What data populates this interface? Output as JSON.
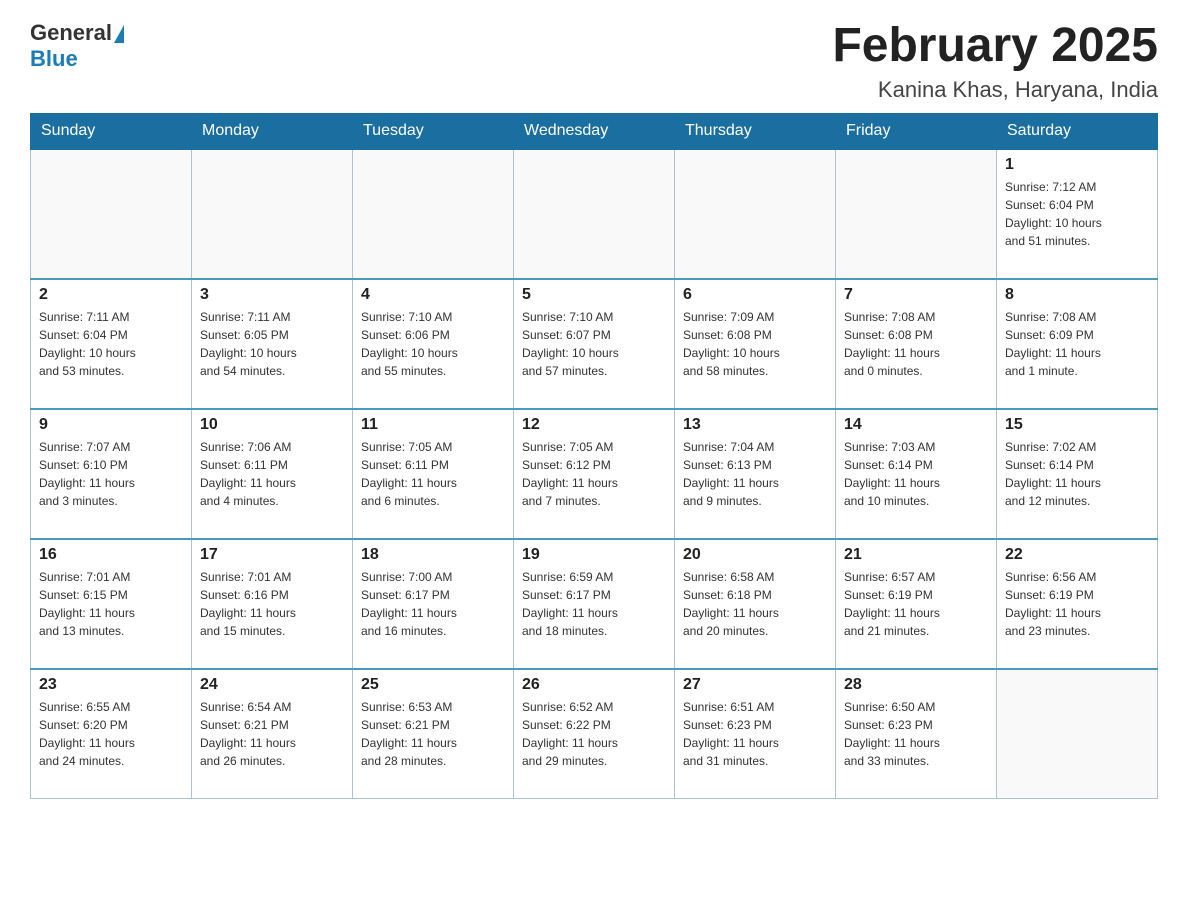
{
  "header": {
    "logo": {
      "general": "General",
      "blue": "Blue"
    },
    "title": "February 2025",
    "subtitle": "Kanina Khas, Haryana, India"
  },
  "weekdays": [
    "Sunday",
    "Monday",
    "Tuesday",
    "Wednesday",
    "Thursday",
    "Friday",
    "Saturday"
  ],
  "weeks": [
    [
      {
        "day": "",
        "info": ""
      },
      {
        "day": "",
        "info": ""
      },
      {
        "day": "",
        "info": ""
      },
      {
        "day": "",
        "info": ""
      },
      {
        "day": "",
        "info": ""
      },
      {
        "day": "",
        "info": ""
      },
      {
        "day": "1",
        "info": "Sunrise: 7:12 AM\nSunset: 6:04 PM\nDaylight: 10 hours\nand 51 minutes."
      }
    ],
    [
      {
        "day": "2",
        "info": "Sunrise: 7:11 AM\nSunset: 6:04 PM\nDaylight: 10 hours\nand 53 minutes."
      },
      {
        "day": "3",
        "info": "Sunrise: 7:11 AM\nSunset: 6:05 PM\nDaylight: 10 hours\nand 54 minutes."
      },
      {
        "day": "4",
        "info": "Sunrise: 7:10 AM\nSunset: 6:06 PM\nDaylight: 10 hours\nand 55 minutes."
      },
      {
        "day": "5",
        "info": "Sunrise: 7:10 AM\nSunset: 6:07 PM\nDaylight: 10 hours\nand 57 minutes."
      },
      {
        "day": "6",
        "info": "Sunrise: 7:09 AM\nSunset: 6:08 PM\nDaylight: 10 hours\nand 58 minutes."
      },
      {
        "day": "7",
        "info": "Sunrise: 7:08 AM\nSunset: 6:08 PM\nDaylight: 11 hours\nand 0 minutes."
      },
      {
        "day": "8",
        "info": "Sunrise: 7:08 AM\nSunset: 6:09 PM\nDaylight: 11 hours\nand 1 minute."
      }
    ],
    [
      {
        "day": "9",
        "info": "Sunrise: 7:07 AM\nSunset: 6:10 PM\nDaylight: 11 hours\nand 3 minutes."
      },
      {
        "day": "10",
        "info": "Sunrise: 7:06 AM\nSunset: 6:11 PM\nDaylight: 11 hours\nand 4 minutes."
      },
      {
        "day": "11",
        "info": "Sunrise: 7:05 AM\nSunset: 6:11 PM\nDaylight: 11 hours\nand 6 minutes."
      },
      {
        "day": "12",
        "info": "Sunrise: 7:05 AM\nSunset: 6:12 PM\nDaylight: 11 hours\nand 7 minutes."
      },
      {
        "day": "13",
        "info": "Sunrise: 7:04 AM\nSunset: 6:13 PM\nDaylight: 11 hours\nand 9 minutes."
      },
      {
        "day": "14",
        "info": "Sunrise: 7:03 AM\nSunset: 6:14 PM\nDaylight: 11 hours\nand 10 minutes."
      },
      {
        "day": "15",
        "info": "Sunrise: 7:02 AM\nSunset: 6:14 PM\nDaylight: 11 hours\nand 12 minutes."
      }
    ],
    [
      {
        "day": "16",
        "info": "Sunrise: 7:01 AM\nSunset: 6:15 PM\nDaylight: 11 hours\nand 13 minutes."
      },
      {
        "day": "17",
        "info": "Sunrise: 7:01 AM\nSunset: 6:16 PM\nDaylight: 11 hours\nand 15 minutes."
      },
      {
        "day": "18",
        "info": "Sunrise: 7:00 AM\nSunset: 6:17 PM\nDaylight: 11 hours\nand 16 minutes."
      },
      {
        "day": "19",
        "info": "Sunrise: 6:59 AM\nSunset: 6:17 PM\nDaylight: 11 hours\nand 18 minutes."
      },
      {
        "day": "20",
        "info": "Sunrise: 6:58 AM\nSunset: 6:18 PM\nDaylight: 11 hours\nand 20 minutes."
      },
      {
        "day": "21",
        "info": "Sunrise: 6:57 AM\nSunset: 6:19 PM\nDaylight: 11 hours\nand 21 minutes."
      },
      {
        "day": "22",
        "info": "Sunrise: 6:56 AM\nSunset: 6:19 PM\nDaylight: 11 hours\nand 23 minutes."
      }
    ],
    [
      {
        "day": "23",
        "info": "Sunrise: 6:55 AM\nSunset: 6:20 PM\nDaylight: 11 hours\nand 24 minutes."
      },
      {
        "day": "24",
        "info": "Sunrise: 6:54 AM\nSunset: 6:21 PM\nDaylight: 11 hours\nand 26 minutes."
      },
      {
        "day": "25",
        "info": "Sunrise: 6:53 AM\nSunset: 6:21 PM\nDaylight: 11 hours\nand 28 minutes."
      },
      {
        "day": "26",
        "info": "Sunrise: 6:52 AM\nSunset: 6:22 PM\nDaylight: 11 hours\nand 29 minutes."
      },
      {
        "day": "27",
        "info": "Sunrise: 6:51 AM\nSunset: 6:23 PM\nDaylight: 11 hours\nand 31 minutes."
      },
      {
        "day": "28",
        "info": "Sunrise: 6:50 AM\nSunset: 6:23 PM\nDaylight: 11 hours\nand 33 minutes."
      },
      {
        "day": "",
        "info": ""
      }
    ]
  ]
}
